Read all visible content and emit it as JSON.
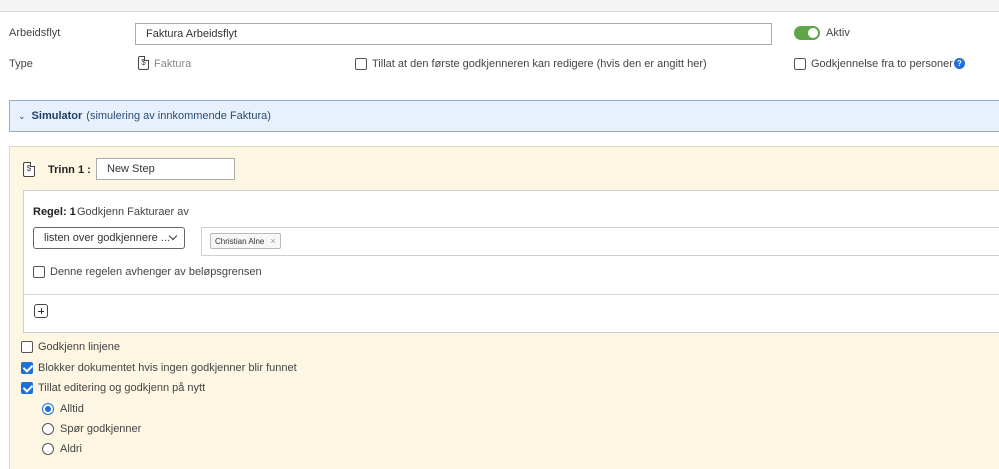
{
  "header": {
    "name_label": "Arbeidsflyt",
    "name_value": "Faktura Arbeidsflyt",
    "active_label": "Aktiv",
    "type_label": "Type",
    "type_value": "Faktura",
    "allow_first_edit_label": "Tillat at den første godkjenneren kan redigere (hvis den er angitt her)",
    "two_person_label": "Godkjennelse fra to personer",
    "help_glyph": "?"
  },
  "simulator": {
    "title": "Simulator",
    "subtitle": "(simulering av innkommende Faktura)"
  },
  "step": {
    "label": "Trinn 1 :",
    "name_value": "New Step",
    "rule": {
      "label": "Regel: 1",
      "description": "Godkjenn Fakturaer av",
      "dropdown_value": "listen over godkjennere ...",
      "approvers": [
        "Christian Alne"
      ],
      "depends_label": "Denne regelen avhenger av beløpsgrensen"
    }
  },
  "options": {
    "approve_lines": "Godkjenn linjene",
    "block_document": "Blokker dokumentet hvis ingen godkjenner blir funnet",
    "allow_edit": "Tillat editering og godkjenn på nytt",
    "radios": [
      "Alltid",
      "Spør godkjenner",
      "Aldri"
    ]
  },
  "colors": {
    "accent": "#1e6fd9",
    "toggle_on": "#5fa54a",
    "step_bg": "#fdf6e3",
    "simulator_bg": "#e8f1fb"
  }
}
